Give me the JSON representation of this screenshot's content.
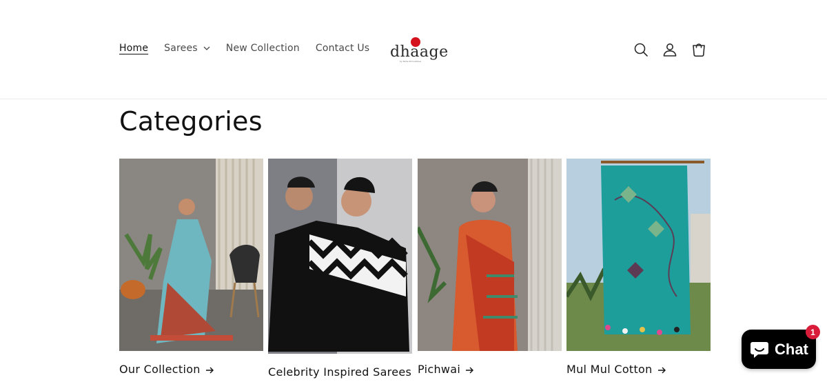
{
  "nav": {
    "home": "Home",
    "sarees": "Sarees",
    "new_collection": "New Collection",
    "contact": "Contact Us"
  },
  "brand": {
    "name": "dhaage",
    "tagline": "by Neha Shrivastava",
    "accent": "#d4111c"
  },
  "header_icons": [
    "search-icon",
    "account-icon",
    "cart-icon"
  ],
  "section": {
    "title": "Categories"
  },
  "categories": [
    {
      "label": "Our Collection"
    },
    {
      "label": "Celebrity Inspired Sarees"
    },
    {
      "label": "Pichwai"
    },
    {
      "label": "Mul Mul Cotton"
    }
  ],
  "chat": {
    "label": "Chat",
    "badge": "1"
  }
}
